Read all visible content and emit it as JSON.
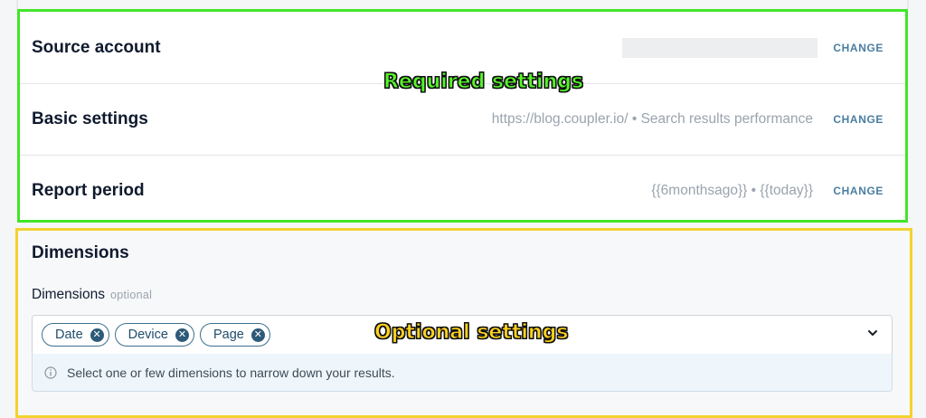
{
  "required_settings": {
    "overlay_label": "Required settings",
    "rows": [
      {
        "title": "Source account",
        "value": "",
        "action": "CHANGE"
      },
      {
        "title": "Basic settings",
        "value": "https://blog.coupler.io/ • Search results performance",
        "action": "CHANGE"
      },
      {
        "title": "Report period",
        "value": "{{6monthsago}} • {{today}}",
        "action": "CHANGE"
      }
    ]
  },
  "optional_settings": {
    "overlay_label": "Optional settings",
    "heading": "Dimensions",
    "field_label": "Dimensions",
    "field_optional": "optional",
    "chips": [
      "Date",
      "Device",
      "Page"
    ],
    "hint": "Select one or few dimensions to narrow down your results."
  },
  "colors": {
    "required_border": "#43e52a",
    "optional_border": "#f2d230",
    "accent": "#4a7ea1"
  },
  "icons": {
    "chip_remove": "close-circle-icon",
    "dropdown": "chevron-down-icon",
    "info": "info-icon"
  }
}
